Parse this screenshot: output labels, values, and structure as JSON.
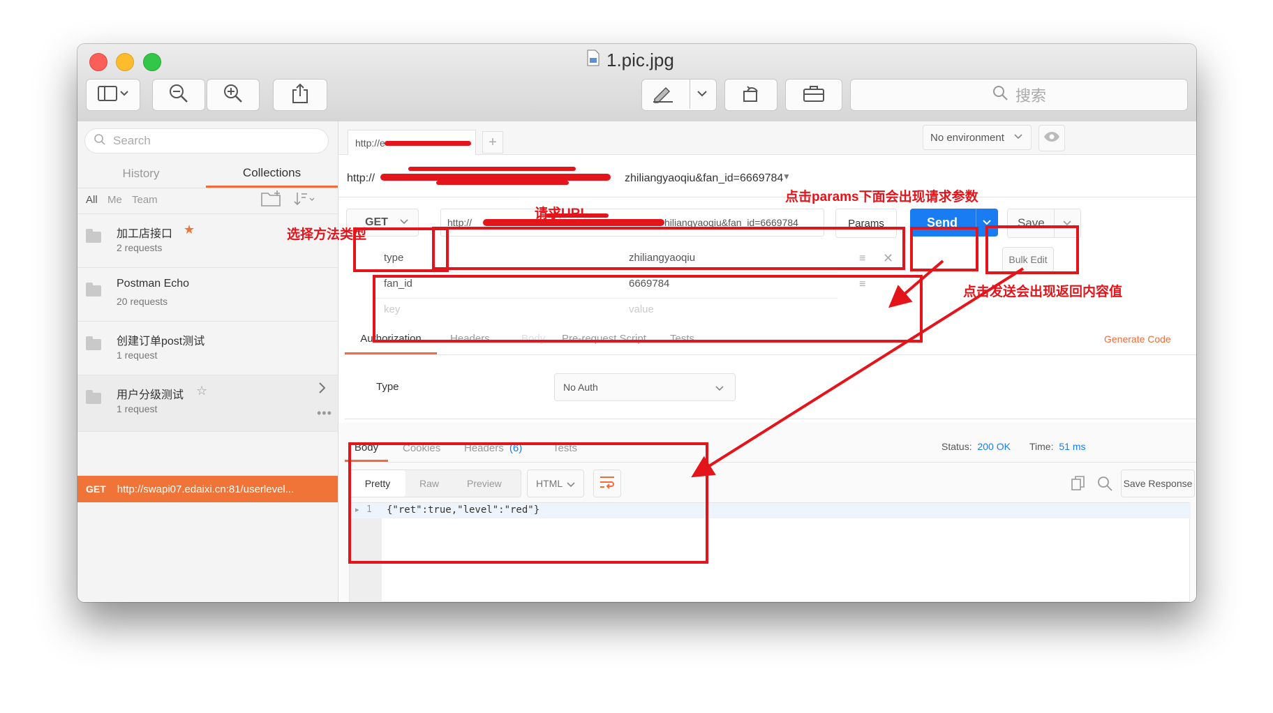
{
  "window": {
    "title": "1.pic.jpg"
  },
  "toolbar": {
    "search_placeholder": "搜索"
  },
  "sidebar": {
    "search_placeholder": "Search",
    "tabs": {
      "history": "History",
      "collections": "Collections"
    },
    "filters": {
      "all": "All",
      "me": "Me",
      "team": "Team"
    },
    "collections": [
      {
        "name": "加工店接口",
        "count": "2 requests",
        "starred": true
      },
      {
        "name": "Postman Echo",
        "count": "20 requests"
      },
      {
        "name": "创建订单post测试",
        "count": "1 request"
      },
      {
        "name": "用户分级测试",
        "count": "1 request",
        "starred": false
      }
    ],
    "active_request": {
      "method": "GET",
      "url": "http://swapi07.edaixi.cn:81/userlevel..."
    }
  },
  "request_tabs": {
    "tab_url": "http://e",
    "add": "+"
  },
  "environment": {
    "selected": "No environment"
  },
  "breadcrumb_url": {
    "prefix": "http://",
    "suffix": "zhiliangyaoqiu&fan_id=6669784"
  },
  "request": {
    "method": "GET",
    "url_prefix": "http://",
    "url_suffix": "hiliangyaoqiu&fan_id=6669784",
    "params_label": "Params",
    "send_label": "Send",
    "save_label": "Save"
  },
  "params": {
    "rows": [
      {
        "key": "type",
        "value": "zhiliangyaoqiu"
      },
      {
        "key": "fan_id",
        "value": "6669784"
      }
    ],
    "key_placeholder": "key",
    "value_placeholder": "value",
    "bulk_edit": "Bulk Edit"
  },
  "req_subtabs": {
    "authorization": "Authorization",
    "headers": "Headers",
    "body": "Body",
    "prerequest": "Pre-request Script",
    "tests": "Tests",
    "generate_code": "Generate Code"
  },
  "auth": {
    "type_label": "Type",
    "type_value": "No Auth"
  },
  "response": {
    "tabs": {
      "body": "Body",
      "cookies": "Cookies",
      "headers": "Headers",
      "headers_count": "(6)",
      "tests": "Tests"
    },
    "status_label": "Status:",
    "status_value": "200 OK",
    "time_label": "Time:",
    "time_value": "51 ms",
    "views": {
      "pretty": "Pretty",
      "raw": "Raw",
      "preview": "Preview",
      "format": "HTML"
    },
    "save_response": "Save Response",
    "line_number": "1",
    "body_text": "{\"ret\":true,\"level\":\"red\"}"
  },
  "annotations": {
    "request_url": "请求URL",
    "params_hint": "点击params下面会出现请求参数",
    "select_method": "选择方法类型",
    "send_hint": "点击发送会出现返回内容值"
  },
  "colors": {
    "accent": "#f07437",
    "send": "#1a7cf2",
    "annotation_red": "#e4141b",
    "link_blue": "#1a7cf2"
  }
}
